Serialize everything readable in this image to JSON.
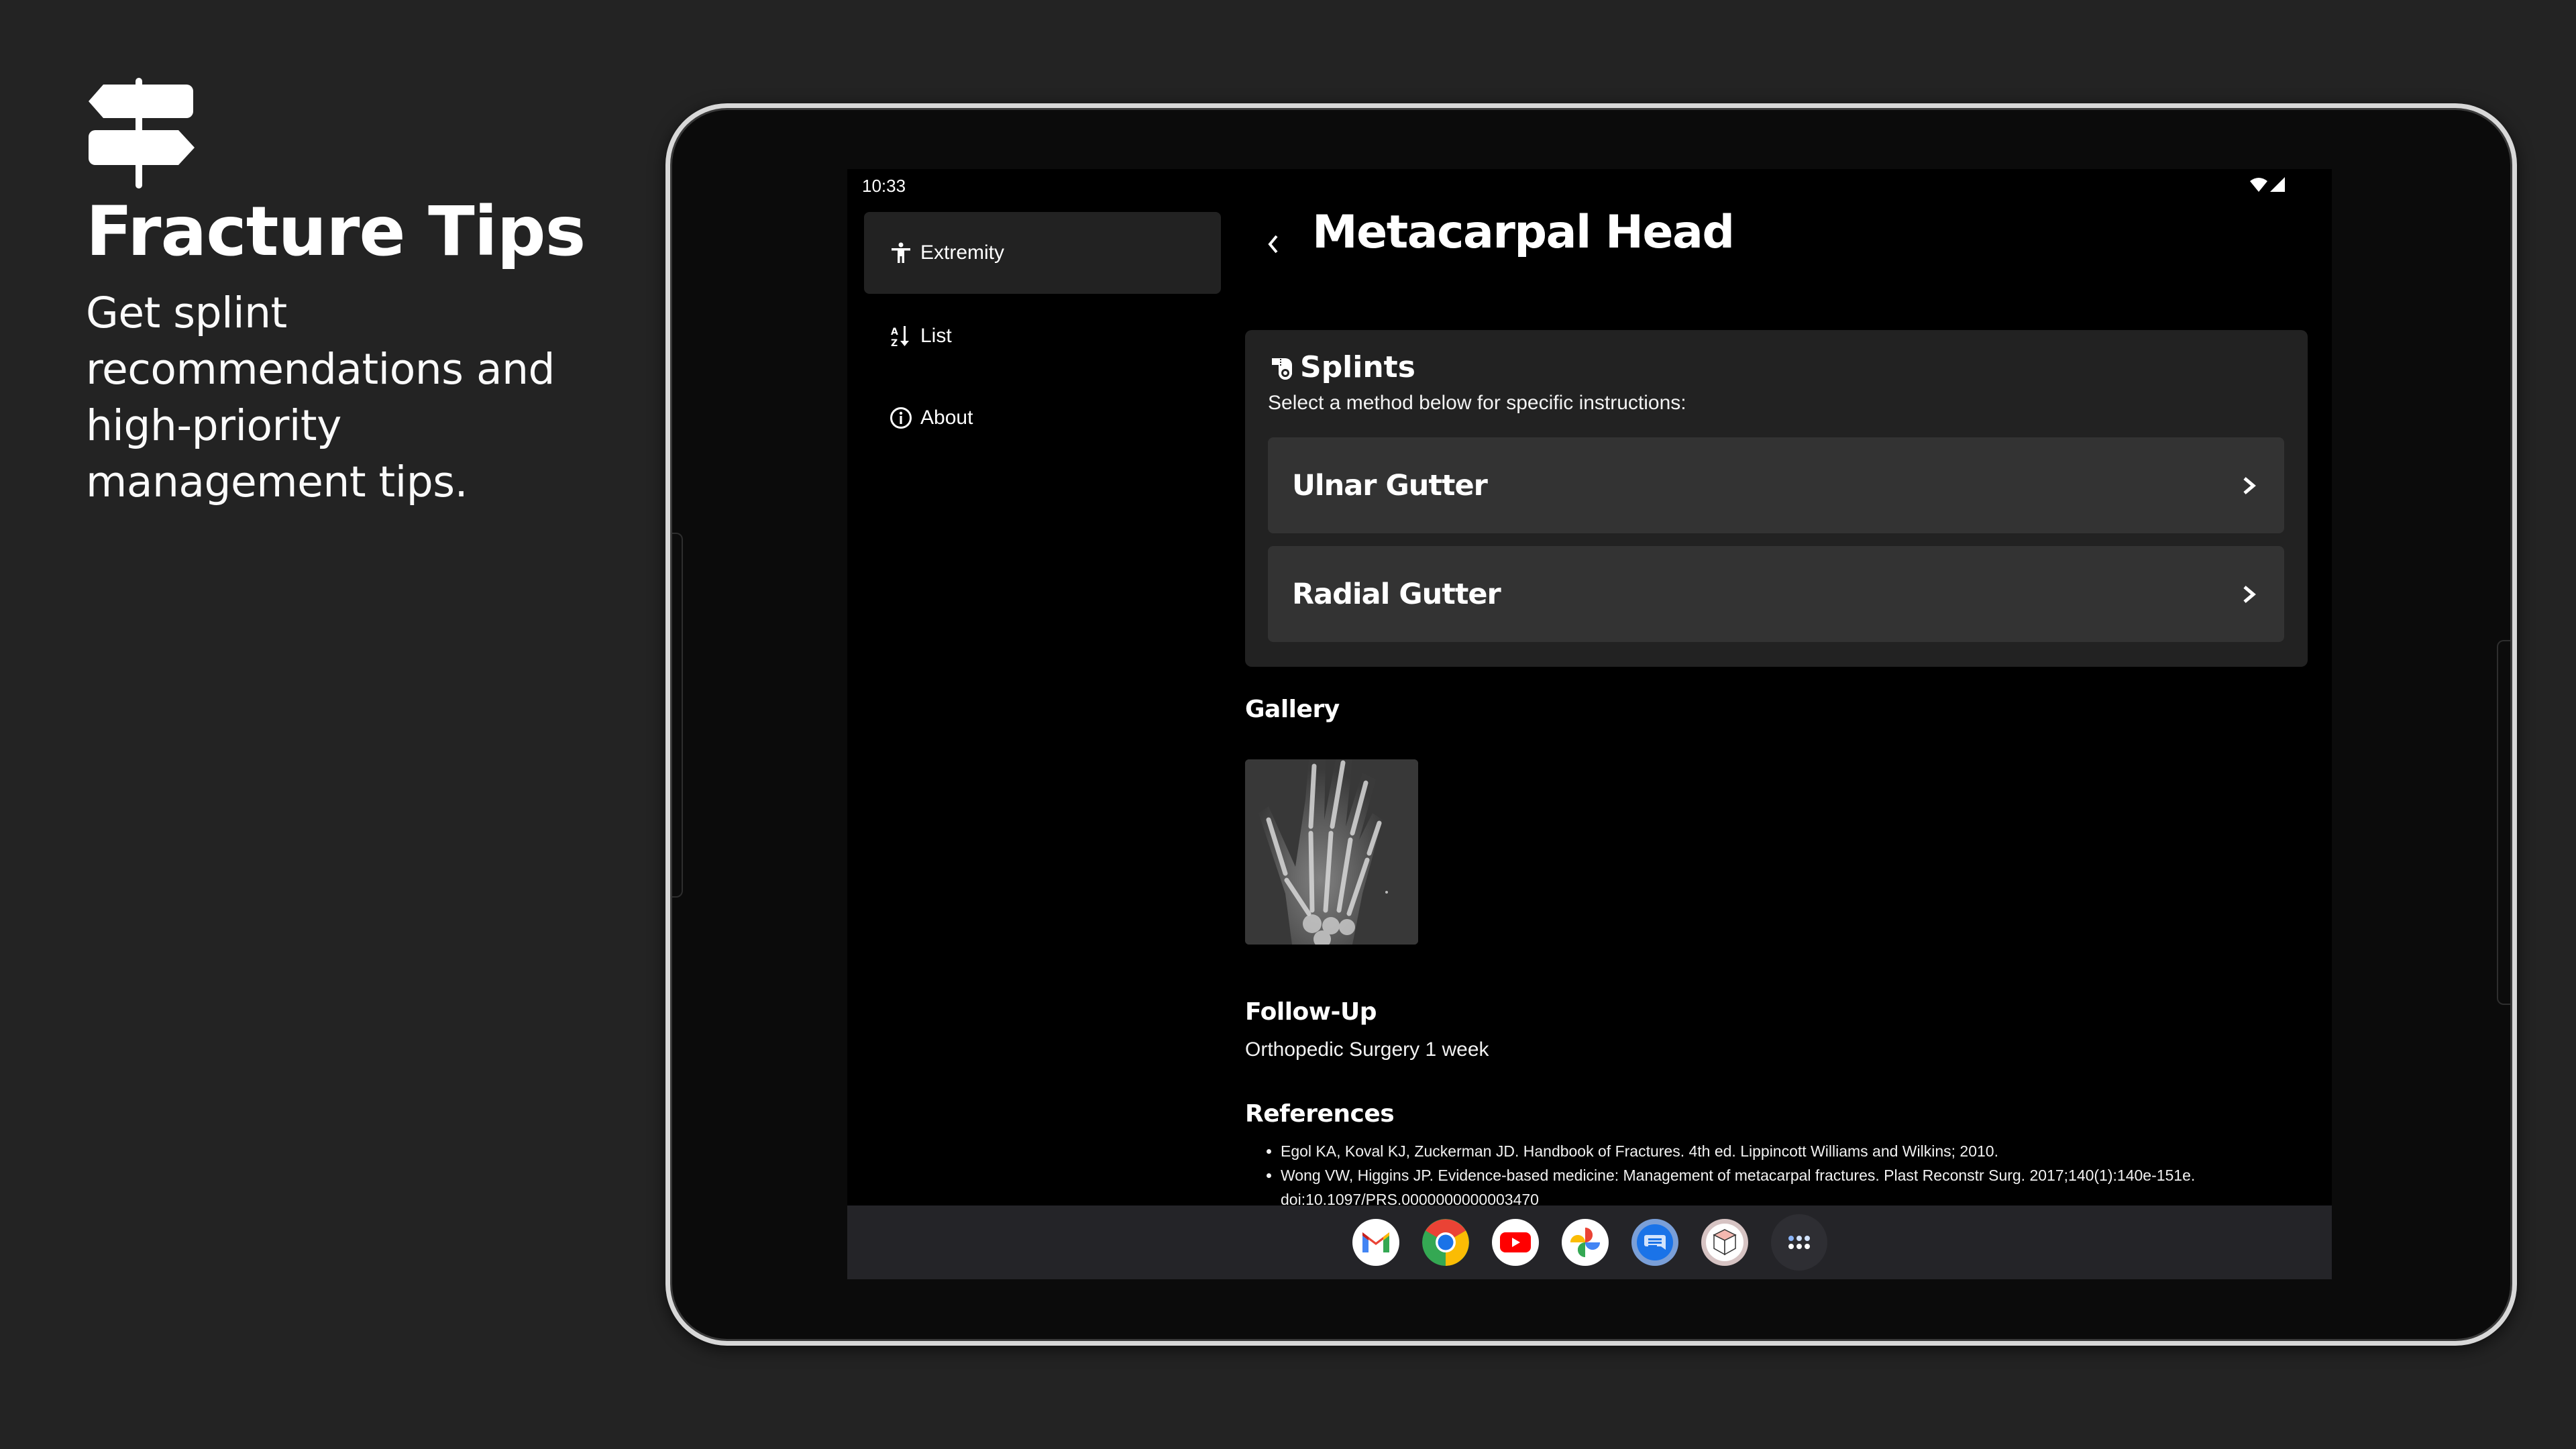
{
  "promo": {
    "title": "Fracture Tips",
    "subtitle": "Get splint recommendations and high-priority management tips.",
    "logo_icon": "signpost-icon"
  },
  "status_bar": {
    "time": "10:33",
    "icons": [
      "wifi-icon",
      "cellular-signal-icon"
    ]
  },
  "sidebar": {
    "items": [
      {
        "label": "Extremity",
        "icon": "accessibility-person-icon",
        "active": true
      },
      {
        "label": "List",
        "icon": "sort-alpha-down-icon",
        "active": false
      },
      {
        "label": "About",
        "icon": "info-circle-icon",
        "active": false
      }
    ]
  },
  "detail": {
    "back_icon": "chevron-left-icon",
    "title": "Metacarpal Head",
    "splints": {
      "heading": "Splints",
      "icon": "bandage-roll-icon",
      "instruction": "Select a method below for specific instructions:",
      "methods": [
        {
          "label": "Ulnar Gutter",
          "icon": "chevron-right-icon"
        },
        {
          "label": "Radial Gutter",
          "icon": "chevron-right-icon"
        }
      ]
    },
    "gallery": {
      "heading": "Gallery",
      "images": [
        "hand x-ray"
      ]
    },
    "follow_up": {
      "heading": "Follow-Up",
      "text": "Orthopedic Surgery 1 week"
    },
    "references": {
      "heading": "References",
      "items": [
        "Egol KA, Koval KJ, Zuckerman JD. Handbook of Fractures. 4th ed. Lippincott Williams and Wilkins; 2010.",
        "Wong VW, Higgins JP. Evidence-based medicine: Management of metacarpal fractures. Plast Reconstr Surg. 2017;140(1):140e-151e. doi:10.1097/PRS.0000000000003470"
      ]
    }
  },
  "dock": {
    "apps": [
      "Gmail",
      "Chrome",
      "YouTube",
      "Photos",
      "Messages",
      "Fracture Tips",
      "App launcher"
    ]
  },
  "colors": {
    "outer_background": "#232323",
    "screen_background": "#000000",
    "card_background": "#222222",
    "row_background": "#333333",
    "dock_background": "#242428",
    "text": "#ffffff"
  }
}
